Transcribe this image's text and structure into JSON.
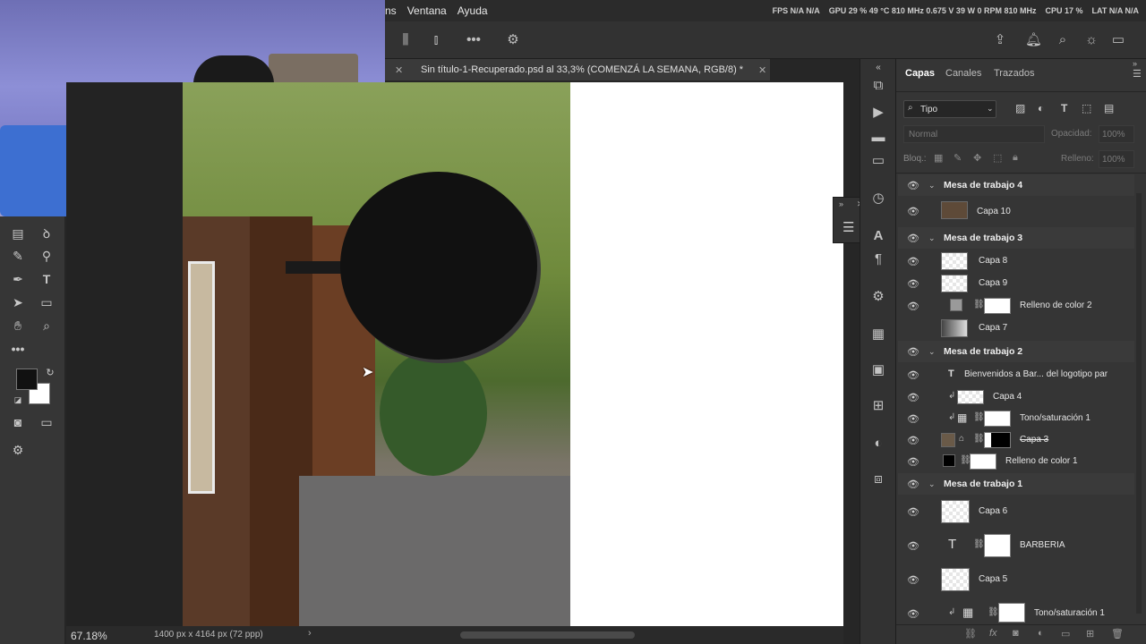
{
  "menu": {
    "items": [
      "ns",
      "Ventana",
      "Ayuda"
    ]
  },
  "stats": {
    "fps": "FPS N/A N/A",
    "gpu": "GPU 29 % 49 °C 810 MHz 0.675 V 39 W 0 RPM 810 MHz",
    "cpu": "CPU 17 %",
    "lat": "LAT N/A N/A"
  },
  "document": {
    "tab_title": "Sin título-1-Recuperado.psd al 33,3% (COMENZÁ LA SEMANA, RGB/8) *"
  },
  "status": {
    "zoom": "67.18%",
    "doc_size": "1400 px x 4164 px (72 ppp)"
  },
  "panel": {
    "tabs": [
      "Capas",
      "Canales",
      "Trazados"
    ],
    "filter": "Tipo",
    "blend_mode": "Normal",
    "opacity_label": "Opacidad:",
    "opacity_value": "100%",
    "lock_label": "Bloq.:",
    "fill_label": "Relleno:",
    "fill_value": "100%"
  },
  "layers": {
    "g4": "Mesa de trabajo 4",
    "capa10": "Capa 10",
    "g3": "Mesa de trabajo 3",
    "capa8": "Capa 8",
    "capa9": "Capa 9",
    "relleno2": "Relleno de color 2",
    "capa7": "Capa 7",
    "g2": "Mesa de trabajo 2",
    "text1": "Bienvenidos a Bar... del logotipo par",
    "capa4": "Capa 4",
    "tono1a": "Tono/saturación 1",
    "capa3": "Capa 3",
    "relleno1": "Relleno de color 1",
    "g1": "Mesa de trabajo 1",
    "capa6": "Capa 6",
    "barberia": "BARBERIA",
    "capa5": "Capa 5",
    "tono1b": "Tono/saturación 1"
  },
  "colors": {
    "foreground": "#111111",
    "background": "#ffffff",
    "accent": "#2d8ceb"
  }
}
